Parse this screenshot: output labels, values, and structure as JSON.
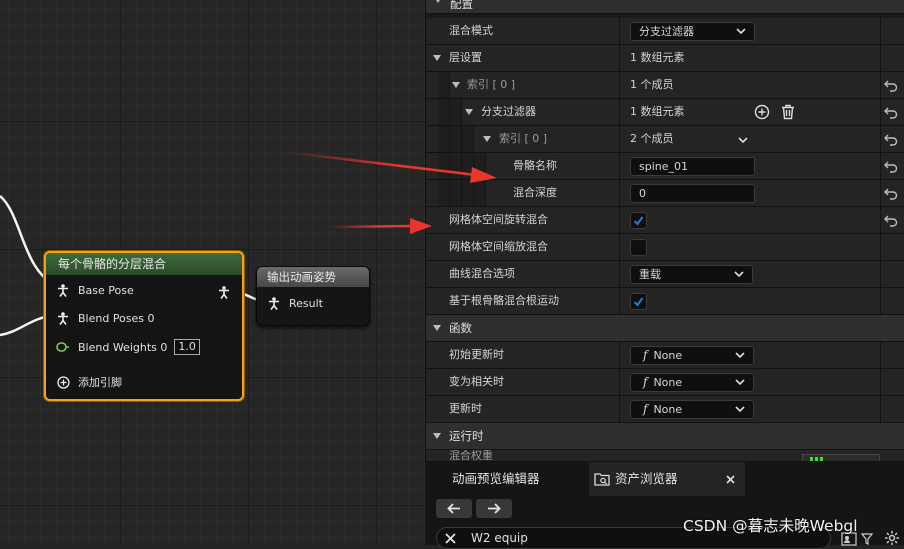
{
  "graph": {
    "blend_node": {
      "title": "每个骨骼的分层混合",
      "pins": [
        "Base Pose",
        "Blend Poses 0",
        "Blend Weights 0"
      ],
      "weight_value": "1.0",
      "add_pin": "添加引脚"
    },
    "output_node": {
      "title": "输出动画姿势",
      "pin": "Result"
    }
  },
  "details": {
    "cat_config": "配置",
    "blend_mode_label": "混合模式",
    "blend_mode_value": "分支过滤器",
    "layer_setup_label": "层设置",
    "layer_setup_value": "1 数组元素",
    "index0_label": "索引 [ 0 ]",
    "index0_value": "1 个成员",
    "branch_filters_label": "分支过滤器",
    "branch_filters_value": "1 数组元素",
    "index0b_label": "索引 [ 0 ]",
    "index0b_value": "2 个成员",
    "bone_name_label": "骨骼名称",
    "bone_name_value": "spine_01",
    "blend_depth_label": "混合深度",
    "blend_depth_value": "0",
    "mesh_rot_label": "网格体空间旋转混合",
    "mesh_rot_checked": true,
    "mesh_scale_label": "网格体空间缩放混合",
    "mesh_scale_checked": false,
    "curve_blend_label": "曲线混合选项",
    "curve_blend_value": "重载",
    "root_motion_label": "基于根骨骼混合根运动",
    "root_motion_checked": true,
    "cat_functions": "函数",
    "init_update_label": "初始更新时",
    "init_update_value": "None",
    "become_relevant_label": "变为相关时",
    "become_relevant_value": "None",
    "on_update_label": "更新时",
    "on_update_value": "None",
    "cat_runtime": "运行时",
    "partial_label": "混合权重"
  },
  "bottom": {
    "tab_anim_preview": "动画预览编辑器",
    "tab_asset_browser": "资产浏览器",
    "search_value": "W2 equip"
  },
  "watermark": "CSDN @暮志未晚Webgl",
  "colors": {
    "accent_check": "#1f7ce0",
    "node_selected": "#f2a31c",
    "node_header_green": "#3f6b3c",
    "annotation_arrow": "#e8362b"
  }
}
